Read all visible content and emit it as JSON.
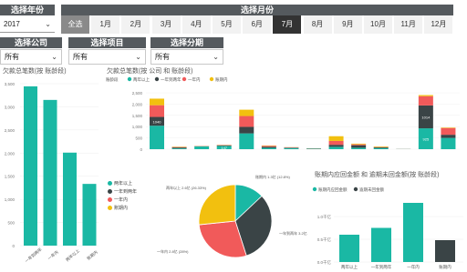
{
  "filters": {
    "year": {
      "header": "选择年份",
      "value": "2017"
    },
    "month": {
      "header": "选择月份",
      "items": [
        "全选",
        "1月",
        "2月",
        "3月",
        "4月",
        "5月",
        "6月",
        "7月",
        "8月",
        "9月",
        "10月",
        "11月",
        "12月"
      ],
      "selected": "7月",
      "all": "全选"
    },
    "company": {
      "header": "选择公司",
      "value": "所有"
    },
    "project": {
      "header": "选择项目",
      "value": "所有"
    },
    "term": {
      "header": "选择分期",
      "value": "所有"
    }
  },
  "colors": {
    "teal": "#1ab8a4",
    "dark": "#3a4446",
    "red": "#f15a5a",
    "yellow": "#f2c00f",
    "header": "#555a5e"
  },
  "chart_data": [
    {
      "type": "bar",
      "title": "欠款总笔数(按 账龄段)",
      "categories": [
        "一年到两年",
        "一年内",
        "两年以上",
        "账期内"
      ],
      "values": [
        3443,
        3149,
        2010,
        1334
      ],
      "ylim": [
        0,
        3500
      ],
      "yticks": [
        "0",
        "500",
        "1,000",
        "1,500",
        "2,000",
        "2,500",
        "3,000",
        "3,500"
      ]
    },
    {
      "type": "bar",
      "title": "欠款总笔数(按 公司 和 账龄段)",
      "legend_title": "账龄段",
      "series": [
        {
          "name": "两年以上",
          "color": "#1ab8a4"
        },
        {
          "name": "一年到两年",
          "color": "#3a4446"
        },
        {
          "name": "一年内",
          "color": "#f15a5a"
        },
        {
          "name": "账期内",
          "color": "#f2c00f"
        }
      ],
      "stacks": [
        [
          1040,
          390,
          520,
          290
        ],
        [
          35,
          40,
          20,
          15
        ],
        [
          120,
          10,
          8,
          4
        ],
        [
          145,
          25,
          15,
          8
        ],
        [
          700,
          290,
          480,
          280
        ],
        [
          60,
          50,
          40,
          15
        ],
        [
          50,
          20,
          15,
          5
        ],
        [
          20,
          10,
          8,
          4
        ],
        [
          105,
          90,
          170,
          210
        ],
        [
          65,
          110,
          40,
          30
        ],
        [
          50,
          35,
          10,
          25
        ],
        [
          5,
          3,
          2,
          1
        ],
        [
          925,
          1014,
          410,
          50
        ],
        [
          500,
          140,
          300,
          20
        ]
      ],
      "data_labels": [
        [
          "",
          "1040",
          "",
          ""
        ],
        [
          "",
          "",
          "",
          ""
        ],
        [
          "",
          "",
          "",
          ""
        ],
        [
          "147",
          "",
          "",
          ""
        ],
        [
          "",
          "",
          "",
          ""
        ],
        [
          "",
          "",
          "",
          ""
        ],
        [
          "",
          "",
          "",
          ""
        ],
        [
          "",
          "",
          "",
          ""
        ],
        [
          "",
          "",
          "",
          ""
        ],
        [
          "",
          "",
          "",
          ""
        ],
        [
          "",
          "",
          "",
          ""
        ],
        [
          "",
          "",
          "",
          ""
        ],
        [
          "925",
          "1014",
          "",
          ""
        ],
        [
          "",
          "",
          "",
          ""
        ]
      ]
    },
    {
      "type": "pie",
      "labels": [
        "账期内",
        "一年到两年",
        "一年内",
        "两年以上"
      ],
      "values": [
        12.8,
        31.78,
        28.0,
        26.33
      ],
      "slice_labels": [
        "账期内 1.3亿 (12.8%)",
        "一年到两年 3.2亿 (31.78%)",
        "一年内 2.8亿 (28%)",
        "两年以上 2.6亿 (26.33%)"
      ],
      "colors": [
        "#3a4446",
        "#3a4446",
        "#f15a5a",
        "#f2c00f"
      ]
    },
    {
      "type": "bar",
      "title": "账期内应回金额 和 逾期未回金额(按 账龄段)",
      "legend": [
        "账期内应回金额",
        "逾期未回金额"
      ],
      "categories": [
        "两年以上",
        "一年到两年",
        "一年内",
        "账期内"
      ],
      "values": [
        0.6,
        0.75,
        1.3,
        0.48
      ],
      "colors": [
        "#1ab8a4",
        "#1ab8a4",
        "#1ab8a4",
        "#3a4446"
      ],
      "yticks": [
        "0.0千亿",
        "0.5千亿",
        "1.0千亿"
      ],
      "ylim": [
        0,
        1.5
      ]
    }
  ]
}
